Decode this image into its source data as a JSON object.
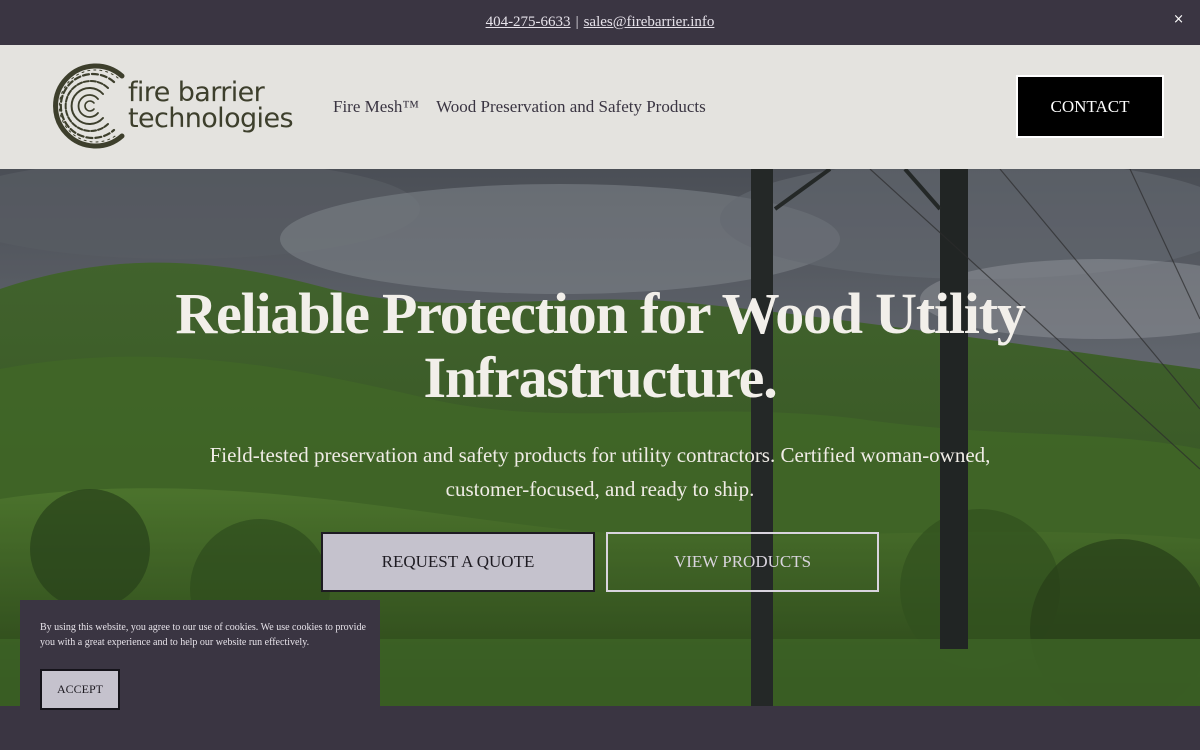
{
  "topbar": {
    "phone": "404-275-6633",
    "separator": "|",
    "email": "sales@firebarrier.info",
    "close_label": "×"
  },
  "header": {
    "logo_line1": "fire barrier",
    "logo_line2": "technologies",
    "nav": [
      {
        "label": "Fire Mesh™"
      },
      {
        "label": "Wood Preservation and Safety Products"
      }
    ],
    "contact_label": "CONTACT"
  },
  "hero": {
    "title_line1": "Reliable Protection for Wood Utility",
    "title_line2": "Infrastructure.",
    "subtitle_line1": "Field-tested preservation and safety products for utility contractors. Certified woman-owned,",
    "subtitle_line2": "customer-focused, and ready to ship.",
    "primary_button": "REQUEST A QUOTE",
    "secondary_button": "VIEW PRODUCTS"
  },
  "cookie": {
    "text": "By using this website, you agree to our use of cookies. We use cookies to provide you with a great experience and to help our website run effectively.",
    "accept_label": "ACCEPT"
  },
  "colors": {
    "brand_dark": "#3a3542",
    "header_bg": "#e4e3df",
    "logo_green": "#3d3f2c",
    "button_lilac": "#c5c2cd"
  }
}
